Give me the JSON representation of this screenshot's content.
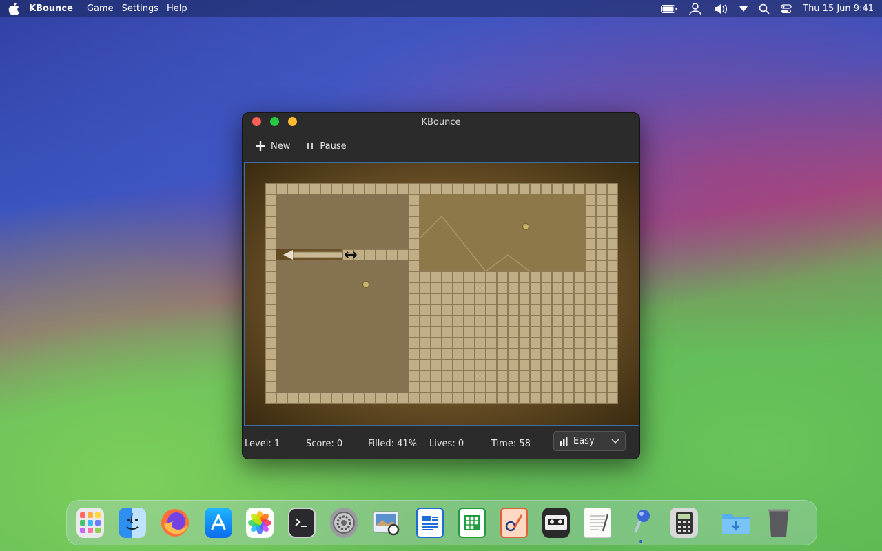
{
  "menubar": {
    "app_name": "KBounce",
    "menus": [
      "Game",
      "Settings",
      "Help"
    ],
    "clock": "Thu 15 Jun 9:41"
  },
  "window": {
    "title": "KBounce",
    "toolbar": {
      "new_label": "New",
      "pause_label": "Pause"
    },
    "status": {
      "level": "Level: 1",
      "score": "Score: 0",
      "filled": "Filled: 41%",
      "lives": "Lives: 0",
      "time": "Time: 58"
    },
    "difficulty": {
      "selected": "Easy"
    }
  },
  "game": {
    "filled_percent": 41,
    "level": 1,
    "score": 0,
    "lives": 0,
    "time": 58
  },
  "dock": {
    "apps": [
      {
        "name": "Launchpad",
        "icon": "launchpad-icon"
      },
      {
        "name": "Finder",
        "icon": "finder-icon"
      },
      {
        "name": "Firefox",
        "icon": "firefox-icon"
      },
      {
        "name": "App Store",
        "icon": "app-store-icon"
      },
      {
        "name": "Photos",
        "icon": "photos-icon"
      },
      {
        "name": "Terminal",
        "icon": "terminal-icon"
      },
      {
        "name": "System Settings",
        "icon": "settings-icon"
      },
      {
        "name": "Preview",
        "icon": "preview-icon"
      },
      {
        "name": "Writer",
        "icon": "writer-icon"
      },
      {
        "name": "Calc",
        "icon": "calc-icon"
      },
      {
        "name": "Draw",
        "icon": "draw-icon"
      },
      {
        "name": "Cassette",
        "icon": "cassette-icon"
      },
      {
        "name": "TextEdit",
        "icon": "textedit-icon"
      },
      {
        "name": "KBounce",
        "icon": "kbounce-icon"
      },
      {
        "name": "Calculator",
        "icon": "calculator-icon"
      },
      {
        "name": "Downloads",
        "icon": "downloads-folder-icon"
      },
      {
        "name": "Trash",
        "icon": "trash-icon"
      }
    ]
  },
  "colors": {
    "accent": "#3d6ea8",
    "tile": "#bfae86",
    "board_bg": "#6a5026"
  }
}
